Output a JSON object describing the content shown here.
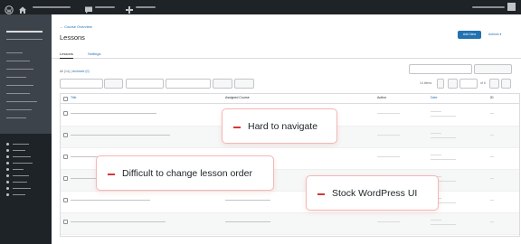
{
  "header": {
    "breadcrumb": "← Course Overview",
    "title": "Lessons",
    "add_button": "Add New",
    "actions": "Actions ▾"
  },
  "tabs": [
    {
      "label": "Lessons",
      "active": true
    },
    {
      "label": "Settings",
      "active": false
    }
  ],
  "filters": {
    "all_label": "All (14)",
    "separator": " | ",
    "archived_label": "Archived (0)",
    "items_count": "14 items",
    "page_of": "of 6"
  },
  "table": {
    "columns": [
      "Title",
      "Assigned Course",
      "Author",
      "Date",
      "ID"
    ]
  },
  "callouts": [
    {
      "text": "Hard to navigate"
    },
    {
      "text": "Difficult to change lesson order"
    },
    {
      "text": "Stock WordPress UI"
    }
  ],
  "icons": {
    "admin_bar": [
      "wordpress-logo-icon",
      "home-icon",
      "comment-icon",
      "plus-icon",
      "user-avatar-icon"
    ]
  },
  "colors": {
    "admin_bar": "#1d2327",
    "sidebar": "#1d2327",
    "sidebar_active": "#3c434a",
    "accent": "#2271b1",
    "callout_accent": "#d63638",
    "callout_border": "#f2b8b5"
  }
}
